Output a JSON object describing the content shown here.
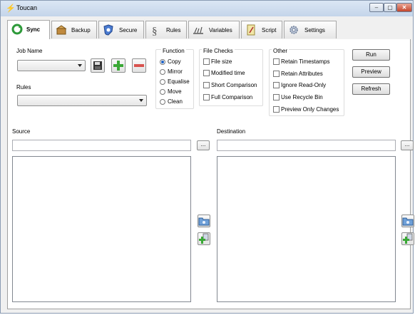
{
  "window": {
    "title": "Toucan"
  },
  "tabs": [
    {
      "label": "Sync",
      "icon": "sync-icon"
    },
    {
      "label": "Backup",
      "icon": "backup-box-icon"
    },
    {
      "label": "Secure",
      "icon": "shield-icon"
    },
    {
      "label": "Rules",
      "icon": "rules-icon"
    },
    {
      "label": "Variables",
      "icon": "variables-icon"
    },
    {
      "label": "Script",
      "icon": "script-icon"
    },
    {
      "label": "Settings",
      "icon": "gear-icon"
    }
  ],
  "active_tab": "Sync",
  "job": {
    "label": "Job Name",
    "value": ""
  },
  "rules": {
    "label": "Rules",
    "value": ""
  },
  "function": {
    "label": "Function",
    "options": [
      "Copy",
      "Mirror",
      "Equalise",
      "Move",
      "Clean"
    ],
    "selected": "Copy"
  },
  "file_checks": {
    "label": "File Checks",
    "options": [
      "File size",
      "Modified time",
      "Short Comparison",
      "Full Comparison"
    ]
  },
  "other": {
    "label": "Other",
    "options": [
      "Retain Timestamps",
      "Retain Attributes",
      "Ignore Read-Only",
      "Use Recycle Bin",
      "Preview Only Changes"
    ]
  },
  "actions": {
    "run": "Run",
    "preview": "Preview",
    "refresh": "Refresh"
  },
  "source": {
    "label": "Source",
    "path": "",
    "browse": "..."
  },
  "destination": {
    "label": "Destination",
    "path": "",
    "browse": "..."
  },
  "colors": {
    "add_green": "#3aa836",
    "remove_red": "#d9534f",
    "accent_blue": "#1f63c6"
  }
}
